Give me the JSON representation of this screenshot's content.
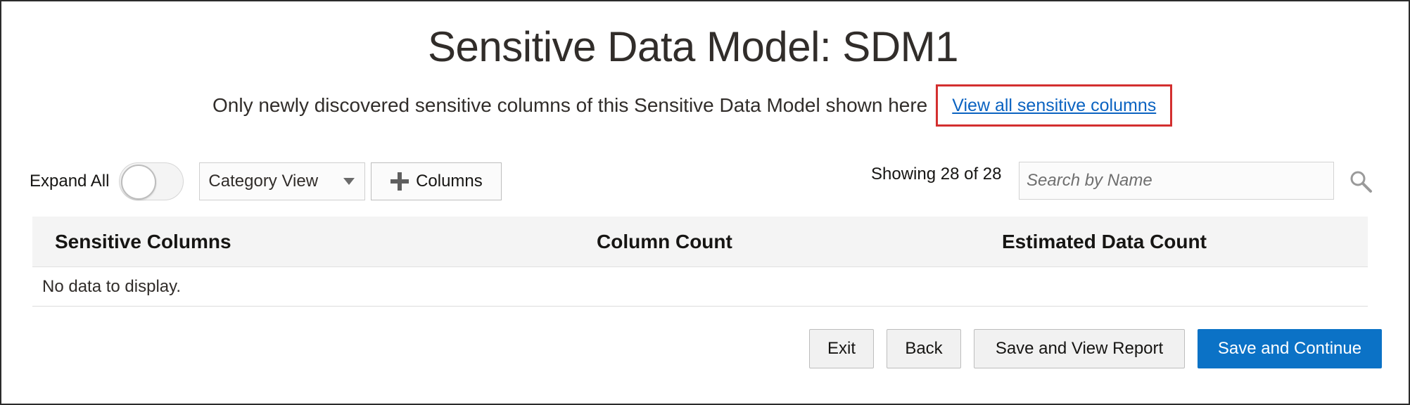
{
  "header": {
    "title": "Sensitive Data Model: SDM1",
    "subtitle": "Only newly discovered sensitive columns of this Sensitive Data Model shown here",
    "view_all_link": "View all sensitive columns"
  },
  "toolbar": {
    "expand_all_label": "Expand All",
    "expand_all_on": false,
    "view_select_value": "Category View",
    "columns_button_label": "Columns",
    "showing_text": "Showing 28 of 28",
    "search_placeholder": "Search by Name"
  },
  "table": {
    "columns": [
      "Sensitive Columns",
      "Column Count",
      "Estimated Data Count"
    ],
    "empty_message": "No data to display."
  },
  "footer": {
    "exit_label": "Exit",
    "back_label": "Back",
    "save_view_report_label": "Save and View Report",
    "save_continue_label": "Save and Continue"
  },
  "colors": {
    "primary": "#0b72c6",
    "link": "#0b63c1",
    "highlight_box": "#d32f2f"
  },
  "icons": {
    "search": "search-icon",
    "plus": "plus-icon",
    "dropdown": "chevron-down-icon"
  }
}
